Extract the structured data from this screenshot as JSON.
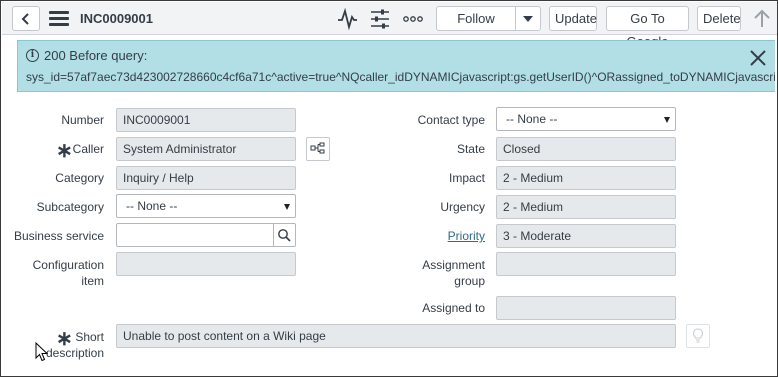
{
  "header": {
    "record_number": "INC0009001",
    "follow_label": "Follow",
    "update_label": "Update",
    "go_to_google_label": "Go To Google",
    "delete_label": "Delete",
    "icons": [
      "back-icon",
      "menu-icon",
      "activity-icon",
      "settings-icon",
      "more-icon",
      "dropdown-caret-icon",
      "up-arrow-icon"
    ]
  },
  "banner": {
    "title": "200 Before query:",
    "query": "sys_id=57af7aec73d423002728660c4cf6a71c^active=true^NQcaller_idDYNAMICjavascript:gs.getUserID()^ORassigned_toDYNAMICjavascript:gs.getUserID()",
    "icons": [
      "info-icon",
      "close-icon"
    ]
  },
  "form": {
    "left": {
      "number": {
        "label": "Number",
        "value": "INC0009001"
      },
      "caller": {
        "label": "Caller",
        "value": "System Administrator",
        "mandatory": true
      },
      "category": {
        "label": "Category",
        "value": "Inquiry / Help"
      },
      "subcategory": {
        "label": "Subcategory",
        "value": "-- None --"
      },
      "business_service": {
        "label": "Business service",
        "value": ""
      },
      "configuration_item": {
        "label_line1": "Configuration",
        "label_line2": "item",
        "value": ""
      }
    },
    "right": {
      "contact_type": {
        "label": "Contact type",
        "value": "-- None --"
      },
      "state": {
        "label": "State",
        "value": "Closed"
      },
      "impact": {
        "label": "Impact",
        "value": "2 - Medium"
      },
      "urgency": {
        "label": "Urgency",
        "value": "2 - Medium"
      },
      "priority": {
        "label": "Priority",
        "value": "3 - Moderate"
      },
      "assignment_group": {
        "label_line1": "Assignment",
        "label_line2": "group",
        "value": ""
      },
      "assigned_to": {
        "label": "Assigned to",
        "value": ""
      }
    },
    "short_description": {
      "label_line1": "Short",
      "label_line2": "description",
      "value": "Unable to post content on a Wiki page",
      "mandatory": true
    }
  },
  "colors": {
    "header_bg": "#f2f3f4",
    "banner_bg": "#b1dfe5",
    "readonly_field_bg": "#e6e9eb",
    "text": "#343d47",
    "link": "#2e6c80"
  }
}
